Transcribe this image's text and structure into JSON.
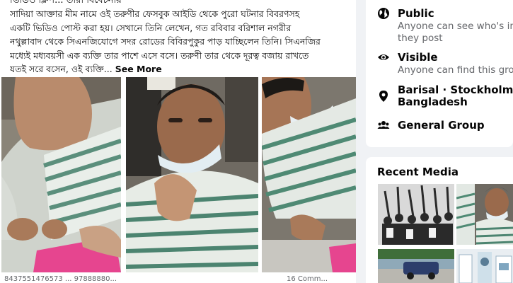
{
  "post": {
    "cut_line": "ভিডিও ক্লিপ... তারা বিবেচনায়",
    "lines": [
      "সাদিয়া আক্তার মীম নামে ওই তরুণীর ফেসবুক আইডি থেকে পুরো ঘটনার বিবরণসহ",
      "একটি ভিডিও পোস্ট করা হয়। সেখানে তিনি লেখেন, গত রবিবার বরিশাল নগরীর",
      "নথুল্লাবাদ থেকে সিএনজিযোগে সদর রোডের বিবিরপুকুর পাড় যাচ্ছিলেন তিনি। সিএনজির",
      "মধ্যেই মধ্যবয়সী এক ব্যক্তি তার পাশে এসে বসে। তরুণী তার থেকে দূরত্ব বজায় রাখতে",
      "যতই সরে বসেন, ওই ব্যক্তি..."
    ],
    "see_more": "See More",
    "footer_left": "8437551476573 ... 97888880...",
    "footer_right": "16 Comm..."
  },
  "about": {
    "public_title": "Public",
    "public_sub_1": "Anyone can see who's in",
    "public_sub_2": "they post",
    "visible_title": "Visible",
    "visible_sub": "Anyone can find this grou",
    "location_line1": "Barisal · Stockholm, S",
    "location_line2": "Bangladesh",
    "group_type": "General Group"
  },
  "media": {
    "title": "Recent Media"
  },
  "icons": {
    "public": "globe-icon",
    "visible": "eye-icon",
    "location": "location-pin-icon",
    "group": "group-icon"
  }
}
